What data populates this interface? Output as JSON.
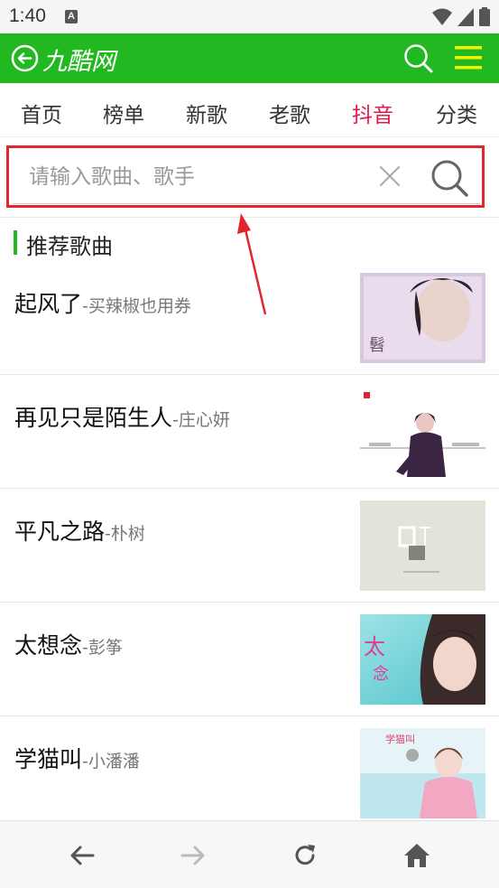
{
  "status_bar": {
    "time": "1:40",
    "notif_letter": "A"
  },
  "app_bar": {
    "title": "九酷网"
  },
  "nav": {
    "tabs": [
      {
        "label": "首页",
        "active": false
      },
      {
        "label": "榜单",
        "active": false
      },
      {
        "label": "新歌",
        "active": false
      },
      {
        "label": "老歌",
        "active": false
      },
      {
        "label": "抖音",
        "active": true
      },
      {
        "label": "分类",
        "active": false
      }
    ]
  },
  "search": {
    "placeholder": "请输入歌曲、歌手",
    "value": ""
  },
  "section": {
    "title": "推荐歌曲"
  },
  "songs": [
    {
      "title": "起风了",
      "artist": "-买辣椒也用券"
    },
    {
      "title": "再见只是陌生人",
      "artist": "-庄心妍"
    },
    {
      "title": "平凡之路",
      "artist": "-朴树"
    },
    {
      "title": "太想念",
      "artist": "-彭筝"
    },
    {
      "title": "学猫叫",
      "artist": "-小潘潘"
    }
  ],
  "colors": {
    "brand_green": "#22b822",
    "active_tab": "#e8154b",
    "highlight_red": "#e0272e"
  },
  "icons": {
    "back": "back-circle-icon",
    "search": "search-icon",
    "menu": "menu-icon",
    "clear": "close-icon",
    "bottom": [
      "arrow-left-icon",
      "arrow-right-icon",
      "refresh-icon",
      "home-icon"
    ]
  }
}
